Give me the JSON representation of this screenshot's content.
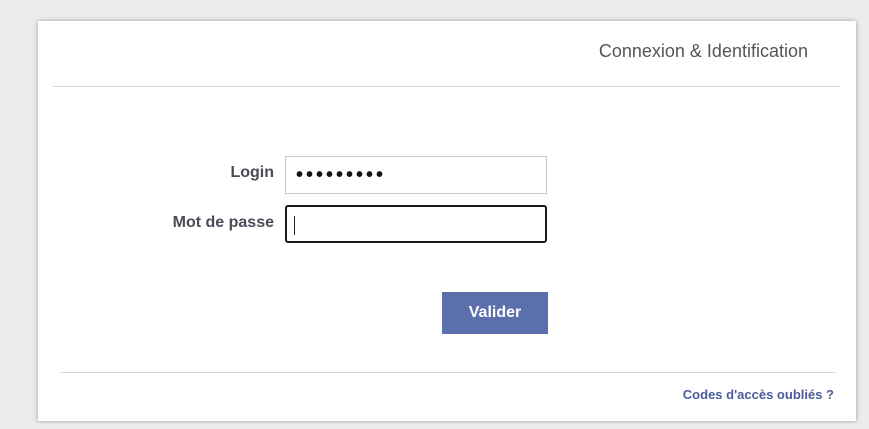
{
  "header": {
    "title": "Connexion & Identification"
  },
  "form": {
    "login_label": "Login",
    "login_value": "•••••••••",
    "password_label": "Mot de passe",
    "password_value": "",
    "submit_label": "Valider"
  },
  "footer": {
    "forgot_link": "Codes d'accès oubliés ?"
  },
  "colors": {
    "accent": "#5b6fad",
    "link": "#4a5d9a",
    "label": "#4a4a58"
  }
}
